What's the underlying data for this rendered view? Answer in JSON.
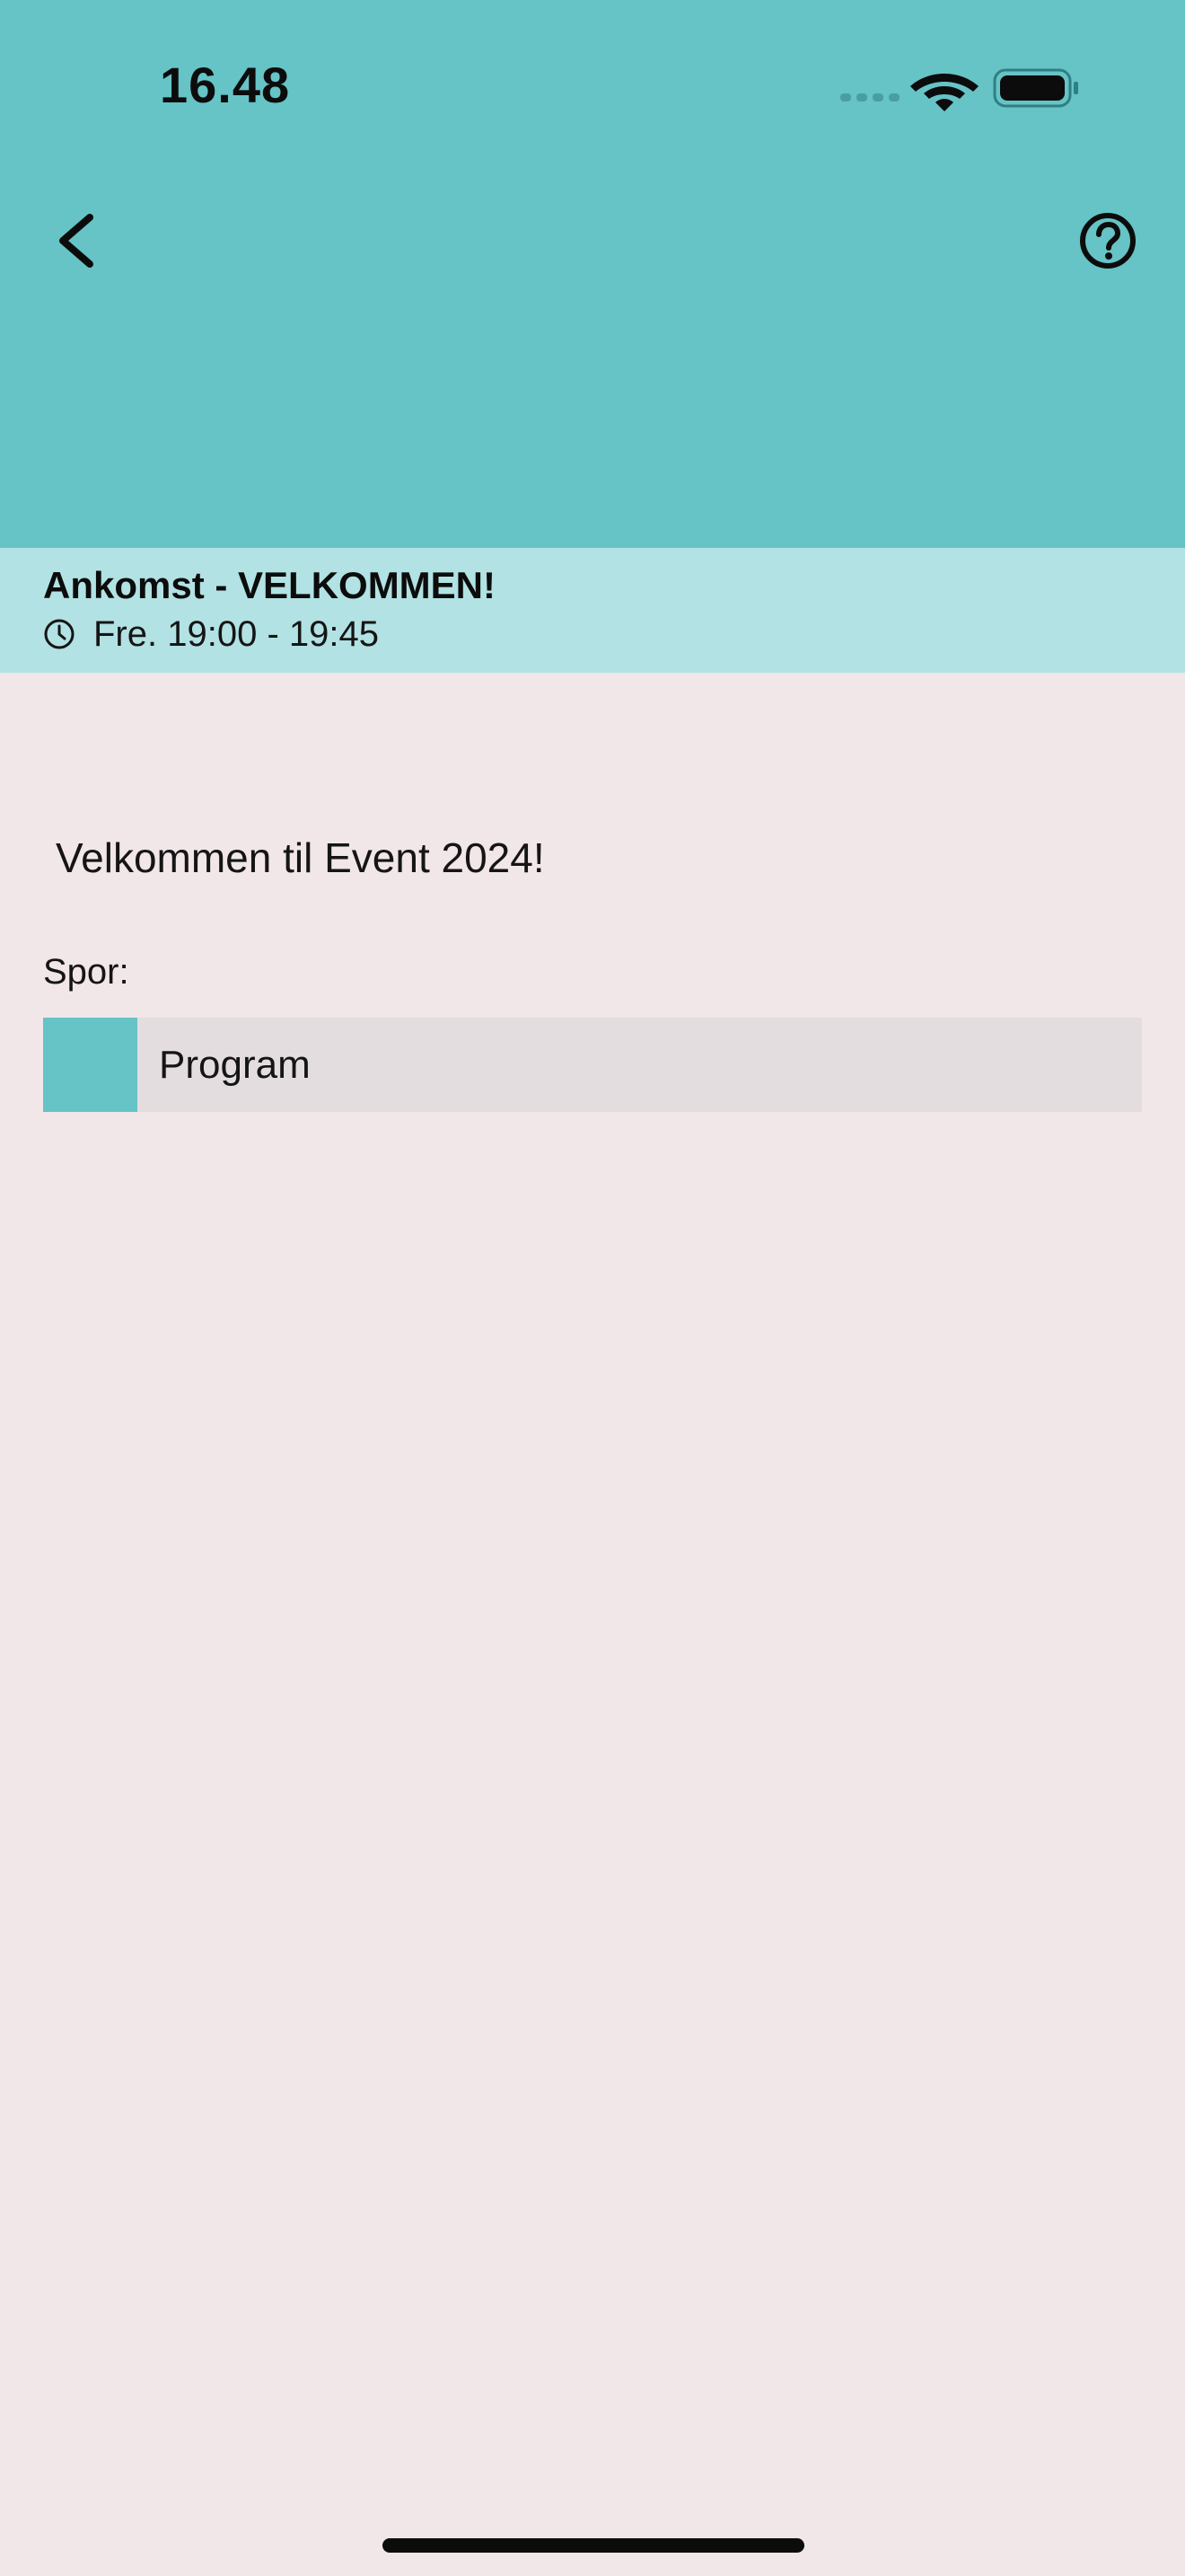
{
  "status_bar": {
    "time": "16.48"
  },
  "header": {
    "accent_color": "#66c3c6",
    "back_icon": "chevron-left-icon",
    "help_icon": "question-circle-icon"
  },
  "session": {
    "title": "Ankomst - VELKOMMEN!",
    "time": "Fre. 19:00 - 19:45",
    "time_icon": "clock-icon",
    "bar_color": "#b2e2e3"
  },
  "content": {
    "description": "Velkommen til Event 2024!",
    "tracks_label": "Spor:",
    "tracks": [
      {
        "name": "Program",
        "color": "#66c3c6"
      }
    ]
  }
}
